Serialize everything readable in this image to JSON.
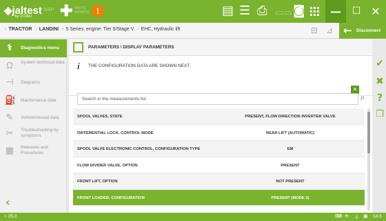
{
  "topbar": {
    "logo": "jaltest",
    "logo_sub": "by COJALI",
    "product": "GRP",
    "plus_label_1": "PARTS",
    "plus_label_2": "MANAGE",
    "warn_glyph": "!",
    "icons": [
      "document-icon",
      "list-icon",
      "printer-icon",
      "battery-icon",
      "camera-icon",
      "help-icon",
      "grid-icon"
    ],
    "help_glyph": "?"
  },
  "breadcrumb": {
    "items": [
      "TRACTOR",
      "LANDINI",
      "5 Series, engine: Tier 5/Stage V",
      "EHC, Hydraulic lift"
    ],
    "disconnect_label": "Disconnect"
  },
  "sidebar": {
    "items": [
      {
        "label": "Diagnostics menu",
        "icon": "stethoscope-icon",
        "active": true
      },
      {
        "label": "System technical data",
        "icon": "omega-icon",
        "active": false
      },
      {
        "label": "Diagrams",
        "icon": "diagram-icon",
        "active": false
      },
      {
        "label": "Maintenance data",
        "icon": "oil-can-icon",
        "active": false
      },
      {
        "label": "Vehicle/vessel data",
        "icon": "wrench-icon",
        "active": false
      },
      {
        "label": "Troubleshooting by symptoms",
        "icon": "tools-icon",
        "active": false
      },
      {
        "label": "Releases and Procedures",
        "icon": "clipboard-icon",
        "active": false
      }
    ]
  },
  "main": {
    "title": "PARAMETERS \\ DISPLAY PARAMETERS",
    "info_text": "THE CONFIGURATION DATA ARE SHOWN NEXT.",
    "search_placeholder": "Search in the measurements list",
    "rows": [
      {
        "param": "SPOOL VALVES, STATE",
        "value": "PRESENT, FLOW DIRECTION INVERTER VALVE"
      },
      {
        "param": "DIFFERENTIAL LOCK, CONTROL MODE",
        "value": "REAR LIFT (AUTOMATIC)"
      },
      {
        "param": "SPOOL VALVE ELECTRONIC CONTROL, CONFIGURATION TYPE",
        "value": "EM"
      },
      {
        "param": "FLOW DIVIDER VALVE, OPTION",
        "value": "PRESENT"
      },
      {
        "param": "FRONT LIFT, OPTION",
        "value": "NOT PRESENT"
      },
      {
        "param": "FRONT LOADER, CONFIGURATION",
        "value": "PRESENT (MODE 2)"
      }
    ],
    "selected_row_index": 5
  },
  "status": {
    "left": "25.3",
    "time": "14:3"
  },
  "colors": {
    "accent": "#7ab32e",
    "accent_dark": "#5e9a1c",
    "warning": "#ef7d00"
  }
}
